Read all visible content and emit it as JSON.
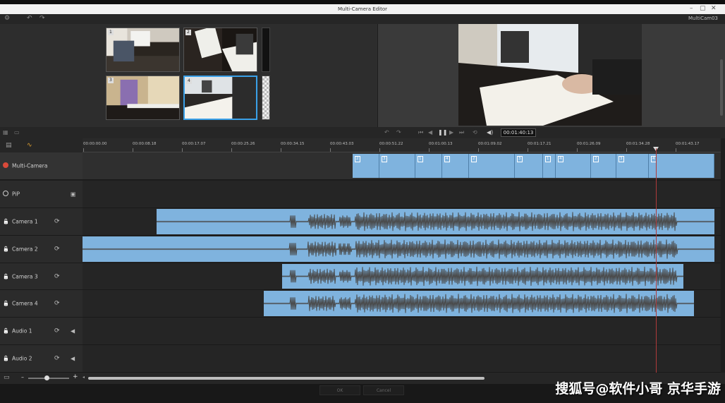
{
  "window": {
    "title": "Multi-Camera Editor",
    "project_name": "MultiCam03"
  },
  "toolbar": {
    "icons": [
      "gear-icon",
      "undo-icon",
      "redo-icon"
    ]
  },
  "source_thumbs": [
    {
      "num": "1",
      "desc": "camera-1-view"
    },
    {
      "num": "2",
      "desc": "camera-2-view"
    },
    {
      "num": "3",
      "desc": "camera-3-view"
    },
    {
      "num": "4",
      "desc": "camera-4-view"
    }
  ],
  "transport": {
    "timecode": "00:01:40:13"
  },
  "ruler": {
    "labels": [
      "00:00:00.00",
      "00:00:08.18",
      "00:00:17.07",
      "00:00:25.26",
      "00:00:34.15",
      "00:00:43.03",
      "00:00:51.22",
      "00:01:00.13",
      "00:01:09.02",
      "00:01:17.21",
      "00:01:26.09",
      "00:01:34.28",
      "00:01:43.17"
    ]
  },
  "tracks": [
    {
      "name": "Multi-Camera",
      "lead": "record-dot"
    },
    {
      "name": "PiP",
      "lead": "ring-dot"
    },
    {
      "name": "Camera 1",
      "lead": "lock-icon"
    },
    {
      "name": "Camera 2",
      "lead": "lock-icon"
    },
    {
      "name": "Camera 3",
      "lead": "lock-icon"
    },
    {
      "name": "Camera 4",
      "lead": "lock-icon"
    },
    {
      "name": "Audio 1",
      "lead": "lock-icon"
    },
    {
      "name": "Audio 2",
      "lead": "lock-icon"
    }
  ],
  "multicam_segments": [
    "2",
    "3",
    "1",
    "4",
    "2",
    "3",
    "1",
    "4",
    "2",
    "3",
    "4"
  ],
  "bottom": {
    "zoom_minus": "–",
    "zoom_plus": "+",
    "ok_label": "OK",
    "cancel_label": "Cancel"
  },
  "watermark": "搜狐号@软件小哥 京华手游"
}
